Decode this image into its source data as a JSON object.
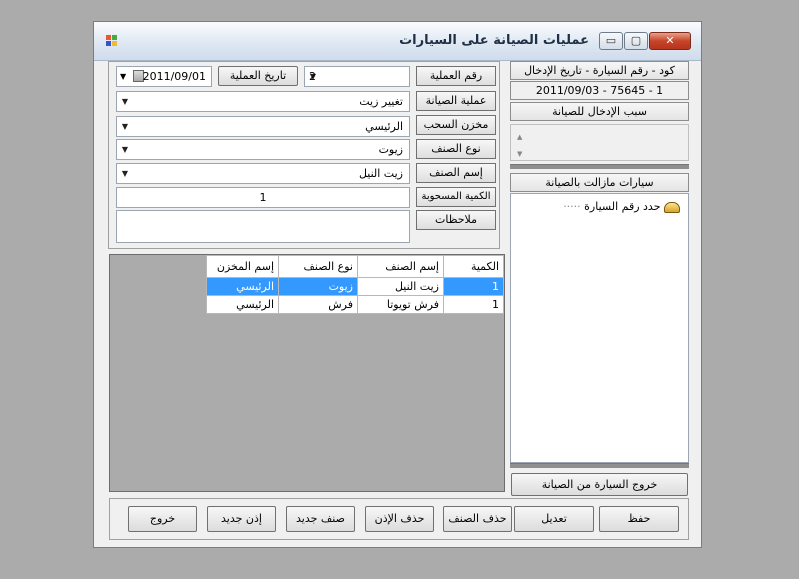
{
  "window": {
    "title": "عمليات الصيانة على السيارات",
    "controls": {
      "minimize": "▭",
      "maximize": "▢",
      "close": "✕"
    }
  },
  "form": {
    "operation_number": {
      "label": "رقم العملية",
      "value": "2"
    },
    "operation_date": {
      "button": "تاريخ العملية",
      "value": "2011/09/01"
    },
    "maintenance_operation": {
      "label": "عملية الصيانة",
      "value": "تغيير زيت"
    },
    "withdraw_store": {
      "label": "مخزن السحب",
      "value": "الرئيسي"
    },
    "item_type": {
      "label": "نوع الصنف",
      "value": "زيوت"
    },
    "item_name": {
      "label": "إسم الصنف",
      "value": "زيت النيل"
    },
    "withdrawn_quantity": {
      "label": "الكمية المسحوبة",
      "value": "1"
    },
    "notes": {
      "label": "ملاحظات",
      "value": ""
    }
  },
  "grid": {
    "columns": [
      "إسم المخزن",
      "نوع الصنف",
      "إسم الصنف",
      "الكمية"
    ],
    "rows": [
      [
        "الرئيسي",
        "زيوت",
        "زيت النيل",
        "1"
      ],
      [
        "الرئيسي",
        "فرش",
        "فرش تويوتا",
        "1"
      ]
    ]
  },
  "right_panel": {
    "car_header": "كود - رقم السيارة - تاريخ الإدخال",
    "car_value": "1 - 75645 - 2011/09/03",
    "reason_header": "سبب الإدخال للصيانة",
    "cars_header": "سيارات مازالت بالصيانة",
    "tree_node": "حدد رقم السيارة",
    "exit_button": "خروج السيارة من الصيانة"
  },
  "footer": {
    "save": "حفظ",
    "edit": "تعديل",
    "delete_item": "حذف الصنف",
    "delete_permit": "حذف الإذن",
    "new_item": "صنف جديد",
    "new_permit": "إذن جديد",
    "exit": "خروج"
  },
  "icons": {
    "dropdown": "▼",
    "calendar": "calendar-icon",
    "tree_folder": "car-folder-icon"
  },
  "colors": {
    "selection": "#3399ff",
    "desktop": "#ababab"
  }
}
